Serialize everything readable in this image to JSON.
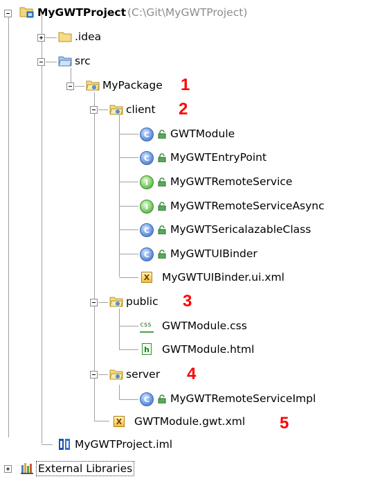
{
  "project": {
    "name": "MyGWTProject",
    "path": "(C:\\Git\\MyGWTProject)"
  },
  "folders": {
    "idea": ".idea",
    "src": "src",
    "package": "MyPackage",
    "client": "client",
    "public": "public",
    "server": "server"
  },
  "client_files": [
    {
      "name": "GWTModule",
      "kind": "class"
    },
    {
      "name": "MyGWTEntryPoint",
      "kind": "class"
    },
    {
      "name": "MyGWTRemoteService",
      "kind": "interface"
    },
    {
      "name": "MyGWTRemoteServiceAsync",
      "kind": "interface"
    },
    {
      "name": "MyGWTSericalazableClass",
      "kind": "class"
    },
    {
      "name": "MyGWTUIBinder",
      "kind": "class"
    },
    {
      "name": "MyGWTUIBinder.ui.xml",
      "kind": "xml"
    }
  ],
  "public_files": [
    {
      "name": "GWTModule.css",
      "kind": "css"
    },
    {
      "name": "GWTModule.html",
      "kind": "html"
    }
  ],
  "server_files": [
    {
      "name": "MyGWTRemoteServiceImpl",
      "kind": "class"
    }
  ],
  "module_file": "GWTModule.gwt.xml",
  "iml_file": "MyGWTProject.iml",
  "external_libraries": "External Libraries",
  "annotations": [
    "1",
    "2",
    "3",
    "4",
    "5"
  ],
  "icon_glyphs": {
    "class": "C",
    "interface": "I",
    "xml": "X",
    "css": "css",
    "html": "h"
  },
  "colors": {
    "annotation": "#ff0000",
    "path": "#8c8c8c",
    "class_icon": "#6d9be3",
    "interface_icon": "#7fcf69"
  }
}
